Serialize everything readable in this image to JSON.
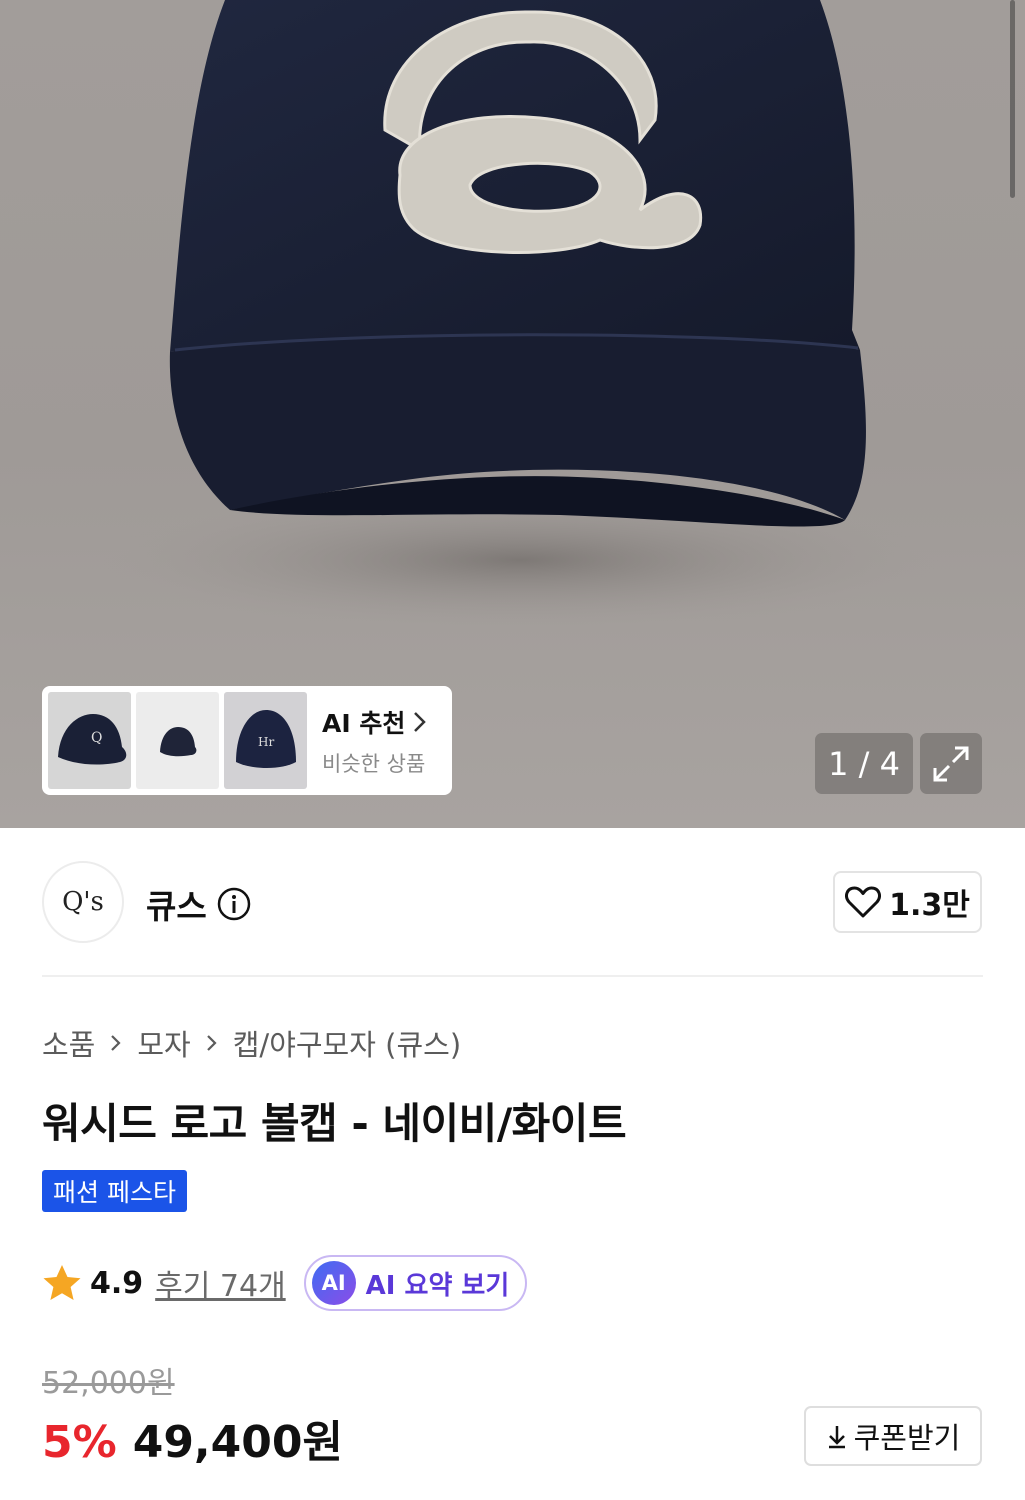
{
  "gallery": {
    "counter": "1 / 4",
    "current_index": 1,
    "total": 4,
    "hero_icon": "navy-cap-q-logo-photo",
    "ai_recommend": {
      "title": "AI 추천",
      "subtitle": "비슷한 상품",
      "thumbnails": [
        "navy-cap-thumbnail",
        "small-cap-thumbnail",
        "navy-cap-front-thumbnail"
      ]
    },
    "expand_icon": "expand-icon"
  },
  "brand": {
    "logo_text": "Q's",
    "name": "큐스",
    "info_icon": "info-icon",
    "like_count": "1.3만",
    "like_icon": "heart-outline-icon"
  },
  "breadcrumb": [
    "소품",
    "모자",
    "캡/야구모자 (큐스)"
  ],
  "product": {
    "title": "워시드 로고 볼캡 - 네이비/화이트",
    "badge": "패션 페스타"
  },
  "rating": {
    "score": "4.9",
    "reviews": "후기 74개",
    "ai_chip": "AI",
    "ai_summary": "AI 요약 보기",
    "star_icon": "star-icon"
  },
  "price": {
    "original": "52,000원",
    "discount": "5%",
    "current": "49,400원",
    "coupon": "쿠폰받기",
    "coupon_icon": "download-icon"
  },
  "colors": {
    "accent_blue": "#1b54e8",
    "discount_red": "#e8262d",
    "ai_purple": "#5a38d8",
    "star": "#f5a623",
    "cap_navy": "#1c2238"
  }
}
